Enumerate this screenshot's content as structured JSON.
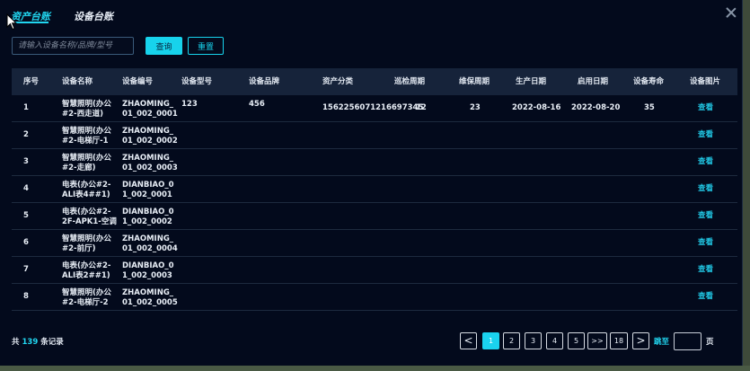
{
  "tabs": {
    "asset": "资产台账",
    "device": "设备台账"
  },
  "search": {
    "placeholder": "请输入设备名称/品牌/型号",
    "value": ""
  },
  "buttons": {
    "query": "查询",
    "reset": "重置"
  },
  "table": {
    "headers": [
      "序号",
      "设备名称",
      "设备编号",
      "设备型号",
      "设备品牌",
      "资产分类",
      "巡检周期",
      "维保周期",
      "生产日期",
      "启用日期",
      "设备寿命",
      "设备图片"
    ],
    "view_label": "查看",
    "rows": [
      {
        "idx": "1",
        "name": [
          "智慧照明(办公",
          "#2-西走道)"
        ],
        "code": [
          "ZHAOMING_",
          "01_002_0001"
        ],
        "model": "123",
        "brand": "456",
        "category": "1562256071216697345",
        "inspection": "12",
        "maintenance": "23",
        "production_date": "2022-08-16",
        "start_date": "2022-08-20",
        "life": "35"
      },
      {
        "idx": "2",
        "name": [
          "智慧照明(办公",
          "#2-电梯厅-1"
        ],
        "code": [
          "ZHAOMING_",
          "01_002_0002"
        ],
        "model": "",
        "brand": "",
        "category": "",
        "inspection": "",
        "maintenance": "",
        "production_date": "",
        "start_date": "",
        "life": ""
      },
      {
        "idx": "3",
        "name": [
          "智慧照明(办公",
          "#2-走廊)"
        ],
        "code": [
          "ZHAOMING_",
          "01_002_0003"
        ],
        "model": "",
        "brand": "",
        "category": "",
        "inspection": "",
        "maintenance": "",
        "production_date": "",
        "start_date": "",
        "life": ""
      },
      {
        "idx": "4",
        "name": [
          "电表(办公#2-",
          "ALI表4##1)"
        ],
        "code": [
          "DIANBIAO_0",
          "1_002_0001"
        ],
        "model": "",
        "brand": "",
        "category": "",
        "inspection": "",
        "maintenance": "",
        "production_date": "",
        "start_date": "",
        "life": ""
      },
      {
        "idx": "5",
        "name": [
          "电表(办公#2-",
          "2F-APK1-空调"
        ],
        "code": [
          "DIANBIAO_0",
          "1_002_0002"
        ],
        "model": "",
        "brand": "",
        "category": "",
        "inspection": "",
        "maintenance": "",
        "production_date": "",
        "start_date": "",
        "life": ""
      },
      {
        "idx": "6",
        "name": [
          "智慧照明(办公",
          "#2-前厅)"
        ],
        "code": [
          "ZHAOMING_",
          "01_002_0004"
        ],
        "model": "",
        "brand": "",
        "category": "",
        "inspection": "",
        "maintenance": "",
        "production_date": "",
        "start_date": "",
        "life": ""
      },
      {
        "idx": "7",
        "name": [
          "电表(办公#2-",
          "ALI表2##1)"
        ],
        "code": [
          "DIANBIAO_0",
          "1_002_0003"
        ],
        "model": "",
        "brand": "",
        "category": "",
        "inspection": "",
        "maintenance": "",
        "production_date": "",
        "start_date": "",
        "life": ""
      },
      {
        "idx": "8",
        "name": [
          "智慧照明(办公",
          "#2-电梯厅-2"
        ],
        "code": [
          "ZHAOMING_",
          "01_002_0005"
        ],
        "model": "",
        "brand": "",
        "category": "",
        "inspection": "",
        "maintenance": "",
        "production_date": "",
        "start_date": "",
        "life": ""
      }
    ]
  },
  "footer": {
    "total_prefix": "共",
    "total_count": "139",
    "total_suffix": "条记录",
    "pages": [
      "1",
      "2",
      "3",
      "4",
      "5",
      ">>",
      "18"
    ],
    "current_page": "1",
    "prev_symbol": "<",
    "next_symbol": ">",
    "goto_label": "跳至",
    "goto_value": "",
    "page_unit": "页"
  },
  "colors": {
    "accent": "#1ad3ee",
    "background": "#030a1c",
    "header_bg": "#16233a"
  },
  "icons": {
    "close": "close-icon",
    "cursor": "mouse-pointer-icon"
  }
}
